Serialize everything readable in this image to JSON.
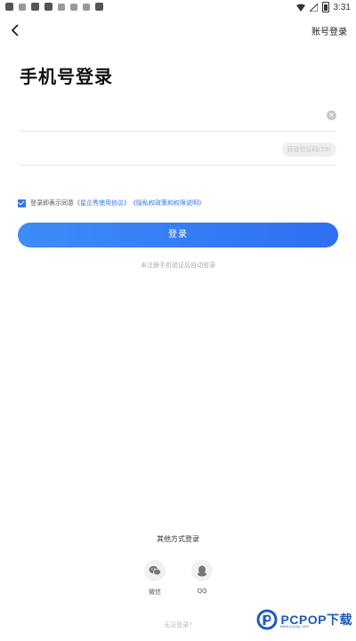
{
  "status_bar": {
    "time": "3:31"
  },
  "header": {
    "account_login": "账号登录"
  },
  "title": "手机号登录",
  "phone_input": {
    "value": "",
    "placeholder": ""
  },
  "code_input": {
    "value": "",
    "placeholder": "",
    "get_code_label": "获取验证码(59)"
  },
  "agreement": {
    "prefix": "登录即表示同意",
    "user_agreement": "《星企秀使用协议》",
    "privacy": "《隐私权政策和权限说明》"
  },
  "login_button": "登录",
  "auto_register_hint": "未注册手机验证后自动登录",
  "other_login": {
    "title": "其他方式登录",
    "wechat": "微信",
    "qq": "QQ"
  },
  "cant_login": "无法登录?",
  "watermark": {
    "text": "PCPOP下载",
    "sub": "www.pcpop.com"
  },
  "colors": {
    "accent": "#2f76f0",
    "wechat": "#777777",
    "qq": "#777777"
  }
}
